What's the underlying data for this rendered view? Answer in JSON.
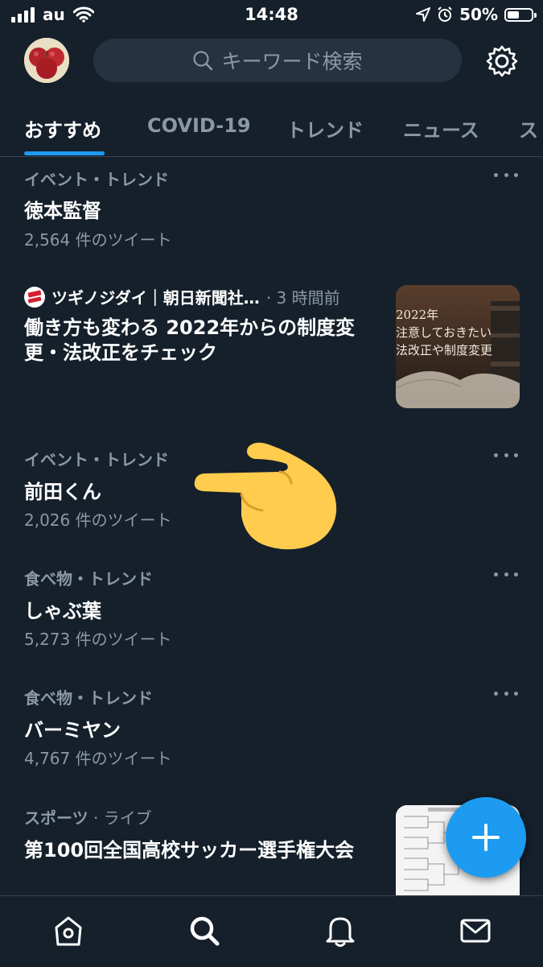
{
  "status_bar": {
    "carrier": "au",
    "time": "14:48",
    "battery": "50%"
  },
  "header": {
    "search_placeholder": "キーワード検索"
  },
  "tabs": [
    {
      "label": "おすすめ"
    },
    {
      "label": "COVID-19"
    },
    {
      "label": "トレンド"
    },
    {
      "label": "ニュース"
    },
    {
      "label": "ス"
    }
  ],
  "trends": [
    {
      "category": "イベント・トレンド",
      "title": "徳本監督",
      "count": "2,564 件のツイート"
    },
    {
      "category": "イベント・トレンド",
      "title": "前田くん",
      "count": "2,026 件のツイート"
    },
    {
      "category": "食べ物・トレンド",
      "title": "しゃぶ葉",
      "count": "5,273 件のツイート"
    },
    {
      "category": "食べ物・トレンド",
      "title": "バーミヤン",
      "count": "4,767 件のツイート"
    }
  ],
  "news": {
    "source": "ツギノジダイ｜朝日新聞社…",
    "time": "· 3 時間前",
    "headline": "働き方も変わる 2022年からの制度変更・法改正をチェック",
    "thumb_lines": [
      "2022年",
      "注意しておきたい",
      "法改正や制度変更"
    ]
  },
  "sports": {
    "category": "スポーツ",
    "live": " · ライブ",
    "title": "第100回全国高校サッカー選手権大会"
  },
  "colors": {
    "background": "#15202b",
    "accent": "#1d9bf0",
    "muted": "#8b98a5",
    "pointer": "#ffcc4d"
  }
}
